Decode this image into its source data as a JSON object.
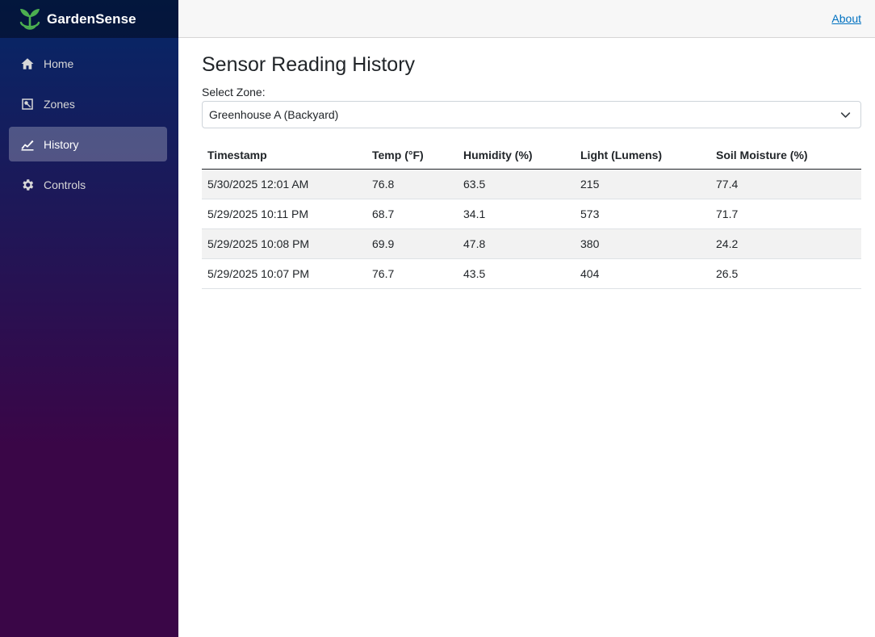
{
  "app": {
    "name": "GardenSense",
    "logo_icon": "sprout-icon"
  },
  "sidebar": {
    "items": [
      {
        "label": "Home",
        "icon": "home-icon",
        "active": false
      },
      {
        "label": "Zones",
        "icon": "zones-icon",
        "active": false
      },
      {
        "label": "History",
        "icon": "chart-line-icon",
        "active": true
      },
      {
        "label": "Controls",
        "icon": "gear-icon",
        "active": false
      }
    ]
  },
  "topbar": {
    "about_label": "About"
  },
  "page": {
    "title": "Sensor Reading History",
    "zone_label": "Select Zone:",
    "zone_selected": "Greenhouse A (Backyard)"
  },
  "table": {
    "headers": [
      "Timestamp",
      "Temp (°F)",
      "Humidity (%)",
      "Light (Lumens)",
      "Soil Moisture (%)"
    ],
    "rows": [
      [
        "5/30/2025 12:01 AM",
        "76.8",
        "63.5",
        "215",
        "77.4"
      ],
      [
        "5/29/2025 10:11 PM",
        "68.7",
        "34.1",
        "573",
        "71.7"
      ],
      [
        "5/29/2025 10:08 PM",
        "69.9",
        "47.8",
        "380",
        "24.2"
      ],
      [
        "5/29/2025 10:07 PM",
        "76.7",
        "43.5",
        "404",
        "26.5"
      ]
    ]
  },
  "colors": {
    "sidebar_top": "#052767",
    "sidebar_bottom": "#3a0647",
    "link": "#0071c1",
    "logo_green": "#4caf50"
  }
}
